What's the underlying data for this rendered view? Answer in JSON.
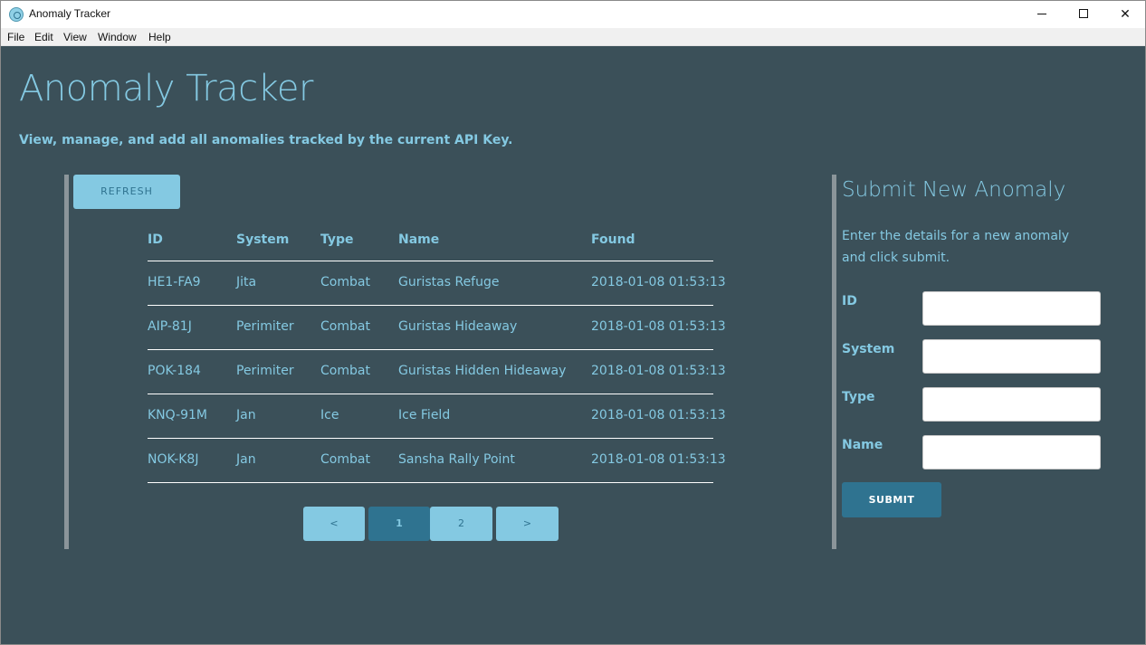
{
  "window": {
    "title": "Anomaly Tracker",
    "controls": {
      "minimize_icon": "minimize-icon",
      "maximize_icon": "maximize-icon",
      "close_symbol": "✕"
    }
  },
  "menubar": {
    "items": [
      "File",
      "Edit",
      "View",
      "Window",
      "Help"
    ]
  },
  "header": {
    "title": "Anomaly Tracker",
    "subtitle": "View, manage, and add all anomalies tracked by the current API Key."
  },
  "toolbar": {
    "refresh_label": "REFRESH"
  },
  "table": {
    "columns": [
      "ID",
      "System",
      "Type",
      "Name",
      "Found"
    ],
    "rows": [
      [
        "HE1-FA9",
        "Jita",
        "Combat",
        "Guristas Refuge",
        "2018-01-08 01:53:13"
      ],
      [
        "AIP-81J",
        "Perimiter",
        "Combat",
        "Guristas Hideaway",
        "2018-01-08 01:53:13"
      ],
      [
        "POK-184",
        "Perimiter",
        "Combat",
        "Guristas Hidden Hideaway",
        "2018-01-08 01:53:13"
      ],
      [
        "KNQ-91M",
        "Jan",
        "Ice",
        "Ice Field",
        "2018-01-08 01:53:13"
      ],
      [
        "NOK-K8J",
        "Jan",
        "Combat",
        "Sansha Rally Point",
        "2018-01-08 01:53:13"
      ]
    ]
  },
  "pagination": {
    "prev": "<",
    "pages": [
      "1",
      "2"
    ],
    "next": ">",
    "current": "1"
  },
  "form": {
    "title": "Submit New Anomaly",
    "description": "Enter the details for a new anomaly and click submit.",
    "fields": [
      {
        "label": "ID",
        "value": ""
      },
      {
        "label": "System",
        "value": ""
      },
      {
        "label": "Type",
        "value": ""
      },
      {
        "label": "Name",
        "value": ""
      }
    ],
    "submit_label": "SUBMIT"
  },
  "colors": {
    "background": "#3b5059",
    "accent_light": "#84c9e2",
    "accent_dark": "#2f7390",
    "panel_border": "#8b959a"
  }
}
